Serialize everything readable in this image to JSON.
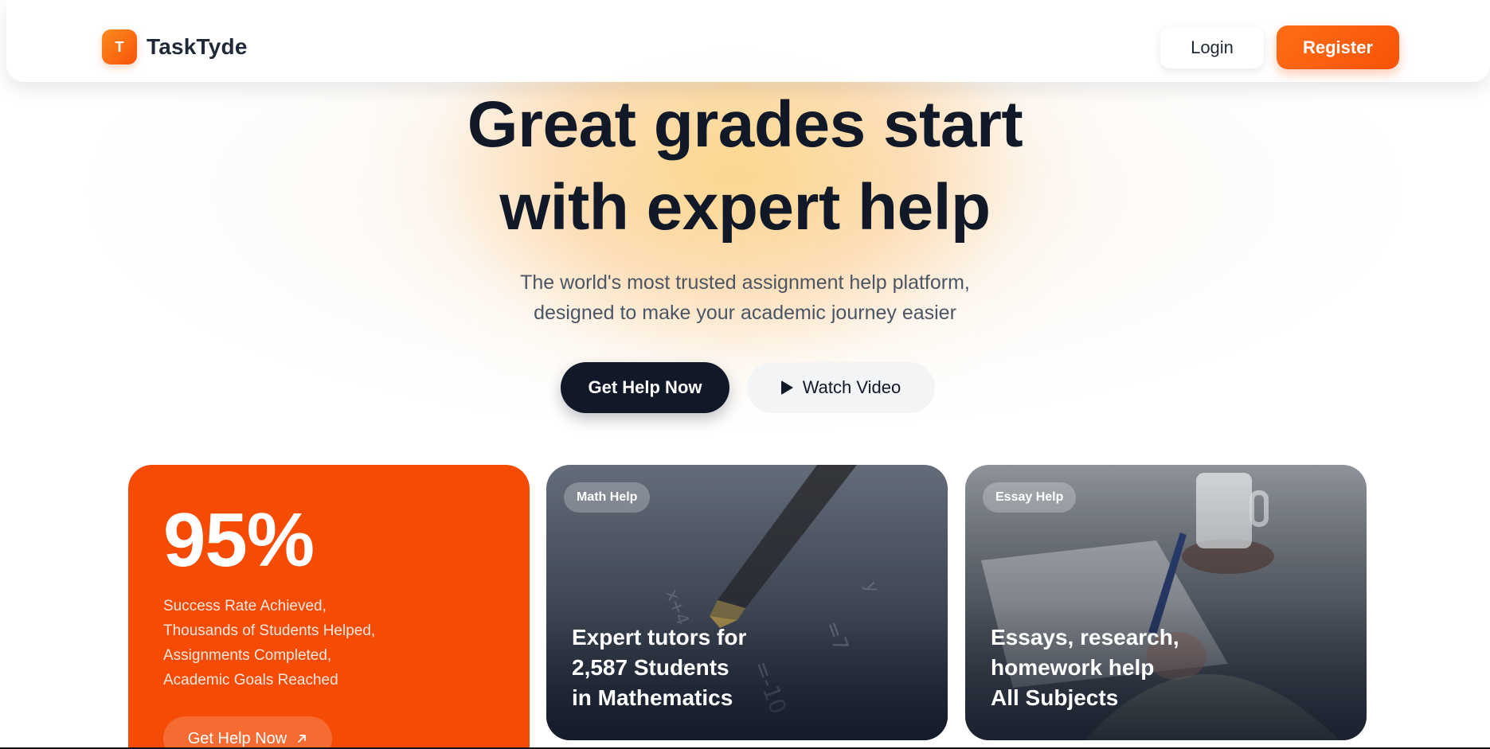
{
  "nav": {
    "logo_letter": "T",
    "brand_name": "TaskTyde",
    "login_label": "Login",
    "register_label": "Register"
  },
  "hero": {
    "title_lines": [
      "Great grades start",
      "with expert help"
    ],
    "subtitle_lines": [
      "The world's most trusted assignment help platform,",
      "designed to make your academic journey easier"
    ],
    "primary_cta": "Get Help Now",
    "secondary_cta": "Watch Video",
    "secondary_cta_icon": "play-icon"
  },
  "cards": {
    "stat": {
      "value": "95%",
      "lines": [
        "Success Rate Achieved,",
        "Thousands of Students Helped,",
        "Assignments Completed,",
        "Academic Goals Reached"
      ],
      "button_label": "Get Help Now",
      "button_icon": "arrow-up-right-icon"
    },
    "math": {
      "tag": "Math Help",
      "caption_lines": [
        "Expert tutors for",
        "2,587 Students",
        "in Mathematics"
      ]
    },
    "essay": {
      "tag": "Essay Help",
      "caption_lines": [
        "Essays, research,",
        "homework help",
        "All Subjects"
      ]
    }
  },
  "colors": {
    "brand_orange": "#f85208",
    "stat_card": "#f54b05",
    "dark": "#111827"
  }
}
